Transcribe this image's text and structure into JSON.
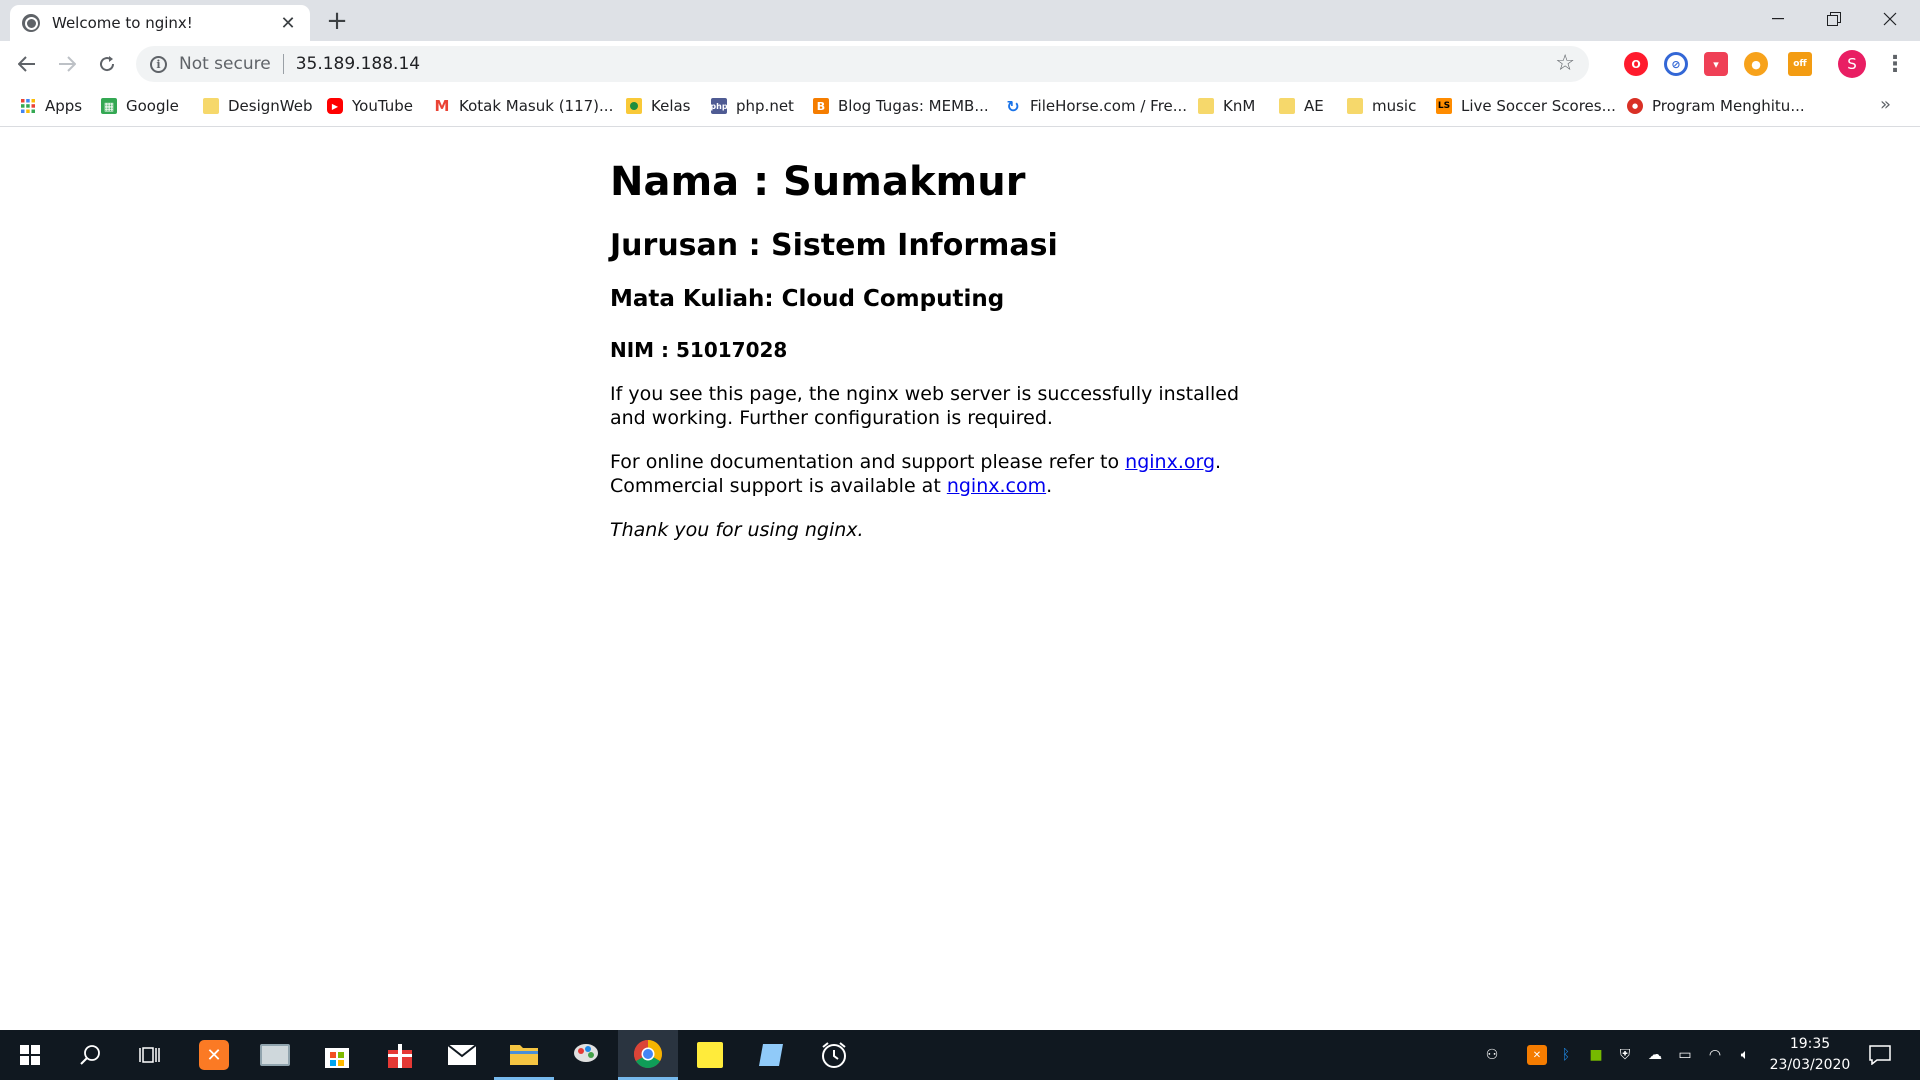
{
  "browser": {
    "tab": {
      "title": "Welcome to nginx!",
      "favicon": "globe-icon"
    },
    "toolbar": {
      "security_label": "Not secure",
      "url": "35.189.188.14"
    },
    "profile_initial": "S",
    "bookmarks": [
      {
        "label": "Apps",
        "icon": "apps-grid-icon"
      },
      {
        "label": "Google",
        "icon": "google-icon"
      },
      {
        "label": "DesignWeb",
        "icon": "folder-icon"
      },
      {
        "label": "YouTube",
        "icon": "youtube-icon"
      },
      {
        "label": "Kotak Masuk (117)...",
        "icon": "gmail-icon"
      },
      {
        "label": "Kelas",
        "icon": "classroom-icon"
      },
      {
        "label": "php.net",
        "icon": "php-icon"
      },
      {
        "label": "Blog Tugas: MEMB...",
        "icon": "blogger-icon"
      },
      {
        "label": "FileHorse.com / Fre...",
        "icon": "filehorse-icon"
      },
      {
        "label": "KnM",
        "icon": "folder-icon"
      },
      {
        "label": "AE",
        "icon": "folder-icon"
      },
      {
        "label": "music",
        "icon": "folder-icon"
      },
      {
        "label": "Live Soccer Scores...",
        "icon": "livescore-icon"
      },
      {
        "label": "Program Menghitu...",
        "icon": "site-icon"
      }
    ]
  },
  "page": {
    "heading_nama": "Nama : Sumakmur",
    "heading_jurusan": "Jurusan : Sistem Informasi",
    "heading_matkul": "Mata Kuliah: Cloud Computing",
    "heading_nim": "NIM : 51017028",
    "para1": "If you see this page, the nginx web server is successfully installed and working. Further configuration is required.",
    "para2_prefix": "For online documentation and support please refer to ",
    "link_org": "nginx.org",
    "para2_mid": ".",
    "para2_line2_prefix": "Commercial support is available at ",
    "link_com": "nginx.com",
    "para2_end": ".",
    "thanks": "Thank you for using nginx."
  },
  "taskbar": {
    "time": "19:35",
    "date": "23/03/2020",
    "active_app": "chrome"
  },
  "colors": {
    "accent_link": "#0000ee",
    "taskbar_bg": "#101820",
    "tab_strip_bg": "#dee1e6",
    "profile": "#e91e63"
  }
}
